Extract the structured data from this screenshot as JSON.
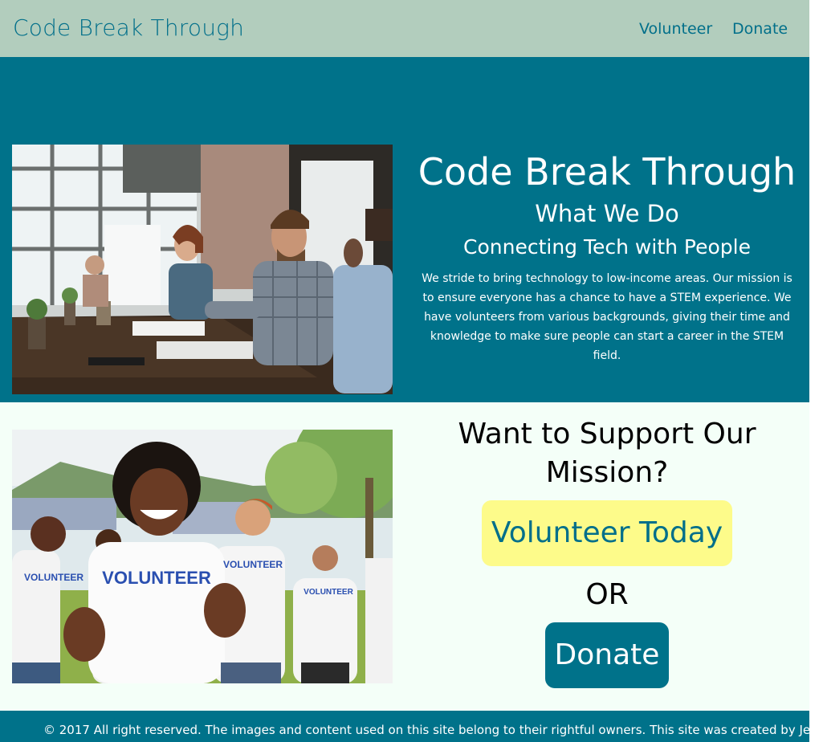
{
  "colors": {
    "nav_bg": "#b2cdbd",
    "brand_teal": "#00728a",
    "support_bg": "#f4fff8",
    "volunteer_btn_bg": "#fdfb8a"
  },
  "nav": {
    "brand": "Code Break Through",
    "links": [
      "Volunteer",
      "Donate"
    ]
  },
  "hero": {
    "title": "Code Break Through",
    "subtitle": "What We Do",
    "tagline": "Connecting Tech with People",
    "paragraph": "We stride to bring technology to low-income areas. Our mission is to ensure everyone has a chance to have a STEM experience. We have volunteers from various backgrounds, giving their time and knowledge to make sure people can start a career in the STEM field.",
    "image": "meeting-photo"
  },
  "support": {
    "heading": "Want to Support Our Mission?",
    "volunteer_button": "Volunteer Today",
    "or_text": "OR",
    "donate_button": "Donate",
    "image": "volunteers-photo"
  },
  "footer": {
    "text": "© 2017 All right reserved. The images and content used on this site belong to their rightful owners. This site was created by Jessica"
  }
}
